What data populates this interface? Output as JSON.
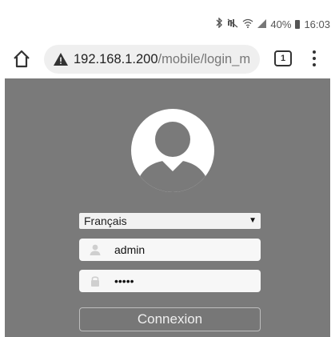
{
  "status_bar": {
    "icons": [
      "bluetooth-icon",
      "mute-icon",
      "wifi-icon",
      "signal-icon",
      "battery-icon"
    ],
    "battery_percent": "40%",
    "time": "16:03"
  },
  "toolbar": {
    "url_host": "192.168.1.200",
    "url_path": "/mobile/login_m",
    "tab_count": "1"
  },
  "login": {
    "language": "Français",
    "username": "admin",
    "password_mask": "•••••",
    "submit_label": "Connexion"
  },
  "colors": {
    "page_background": "#7a7a7a",
    "field_background": "#f7f7f7"
  }
}
